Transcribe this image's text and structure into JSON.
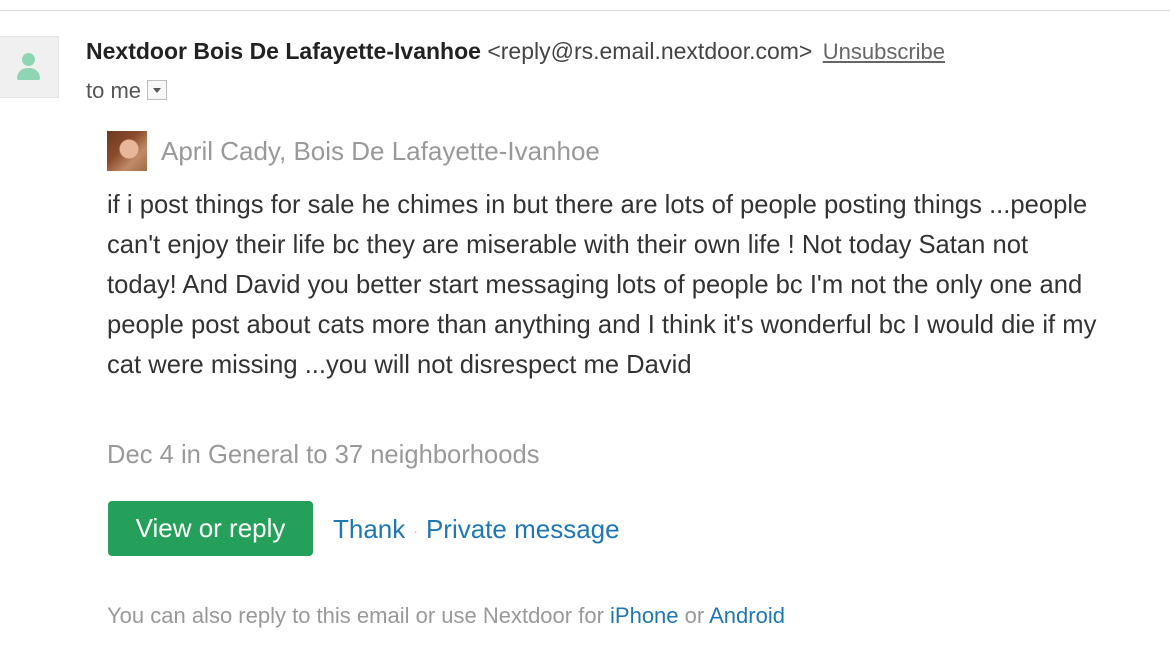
{
  "email": {
    "sender_name": "Nextdoor Bois De Lafayette-Ivanhoe",
    "sender_email": "<reply@rs.email.nextdoor.com>",
    "unsubscribe_label": "Unsubscribe",
    "to_label": "to me"
  },
  "post": {
    "author": "April Cady, Bois De Lafayette-Ivanhoe",
    "body": "if i post things for sale he chimes in but there are lots of people posting things ...people can't enjoy their life bc they are miserable with their own life ! Not today Satan not today! And David you better start messaging lots of people bc I'm not the only one and people post about cats more than anything and I think it's wonderful bc I would die if my cat were missing ...you will not disrespect me David",
    "meta": "Dec 4 in General to 37 neighborhoods"
  },
  "actions": {
    "view_reply_label": "View or reply",
    "thank_label": "Thank",
    "separator": "·",
    "private_message_label": "Private message"
  },
  "footer": {
    "text_prefix": "You can also reply to this email or use Nextdoor for",
    "iphone_label": "iPhone",
    "or_label": "or",
    "android_label": "Android"
  },
  "colors": {
    "accent_green": "#25a05a",
    "link_blue": "#1f77b4",
    "avatar_green": "#8dd5b4"
  }
}
